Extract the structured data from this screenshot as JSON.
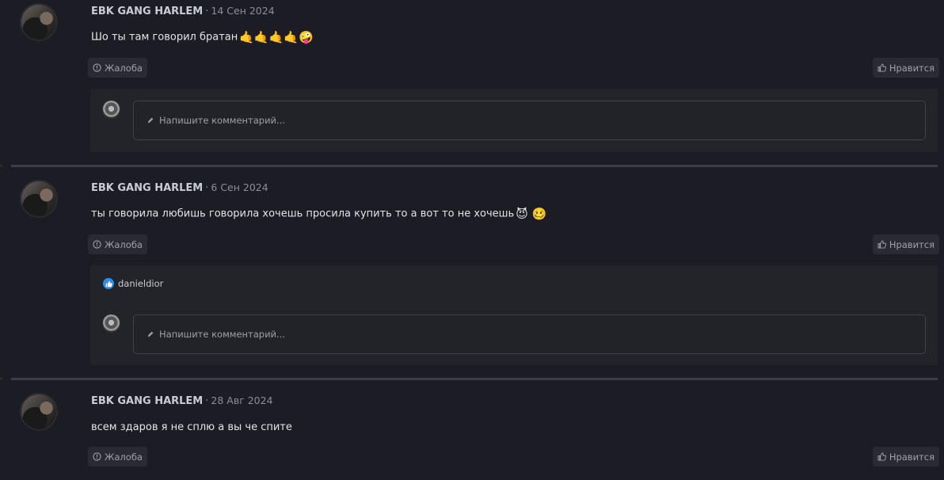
{
  "posts": [
    {
      "author": "EBK GANG HARLEM",
      "sep": "·",
      "date": "14 Сен 2024",
      "message": "Шо ты там говорил братан",
      "emojis": "🤙🤙🤙🤙🤪",
      "report_label": "Жалоба",
      "like_label": "Нравится",
      "comment_placeholder": "Напишите комментарий..."
    },
    {
      "author": "EBK GANG HARLEM",
      "sep": "·",
      "date": "6 Сен 2024",
      "message": "ты говорила любишь говорила хочешь просила купить то а вот то не хочешь",
      "emojis": "😈 🥴",
      "report_label": "Жалоба",
      "like_label": "Нравится",
      "liker": "danieldior",
      "comment_placeholder": "Напишите комментарий..."
    },
    {
      "author": "EBK GANG HARLEM",
      "sep": "·",
      "date": "28 Авг 2024",
      "message": "всем здаров я не сплю а вы че спите",
      "report_label": "Жалоба",
      "like_label": "Нравится"
    }
  ],
  "icons": {
    "report": "info-circle-icon",
    "like": "thumbs-up-icon",
    "pencil": "pencil-icon"
  },
  "colors": {
    "background": "#1c1d24",
    "panel": "#232429",
    "accent_like": "#2d8cf0"
  }
}
